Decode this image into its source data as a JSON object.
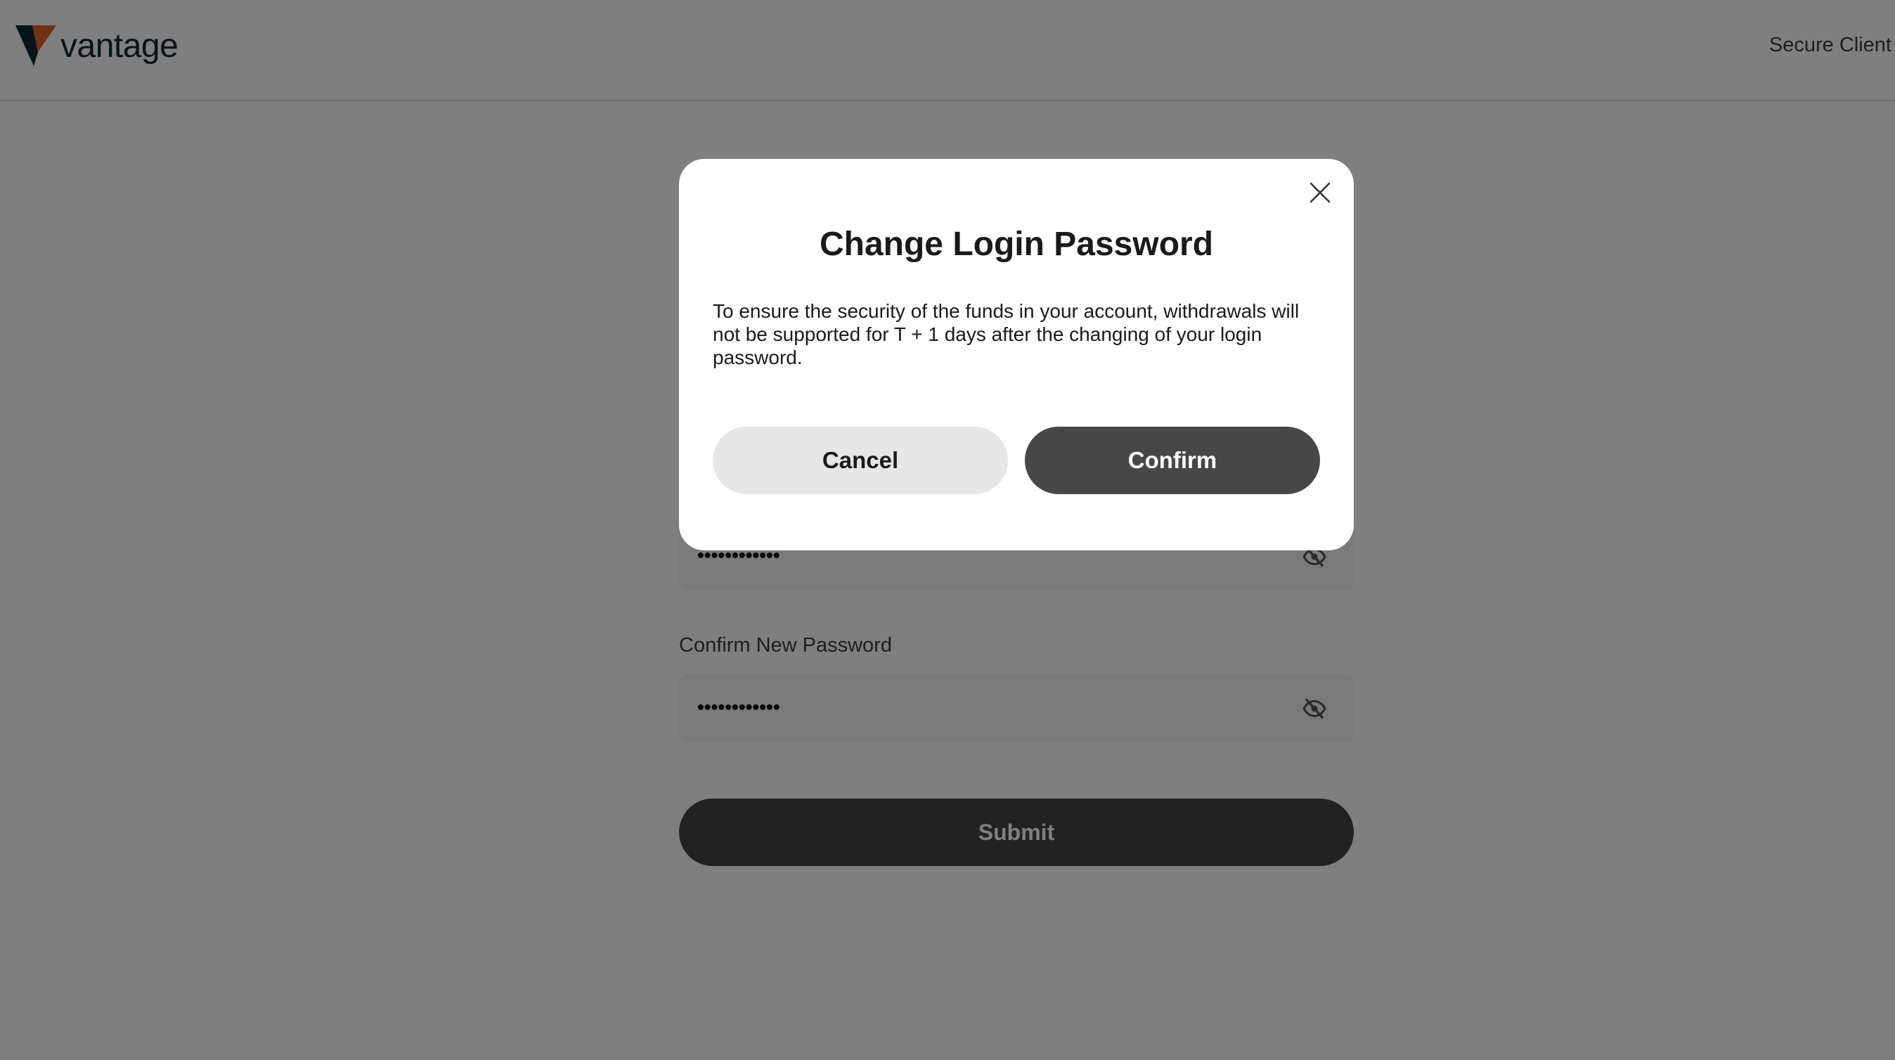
{
  "header": {
    "logo_text": "vantage",
    "right_text": "Secure Client"
  },
  "form": {
    "new_password": {
      "value": "••••••••••••"
    },
    "confirm_label": "Confirm New Password",
    "confirm_password": {
      "value": "••••••••••••"
    },
    "submit_label": "Submit"
  },
  "modal": {
    "title": "Change Login Password",
    "body": "To ensure the security of the funds in your account, withdrawals will not be supported for T + 1 days after the changing of your login password.",
    "cancel_label": "Cancel",
    "confirm_label": "Confirm"
  },
  "colors": {
    "logo_orange": "#e0622b",
    "logo_navy": "#0d2a35",
    "overlay": "rgba(0,0,0,0.5)",
    "primary_button": "#474747"
  },
  "icons": {
    "close": "close-icon",
    "eye_hidden": "eye-off-icon",
    "logo": "vantage-logo-icon"
  }
}
